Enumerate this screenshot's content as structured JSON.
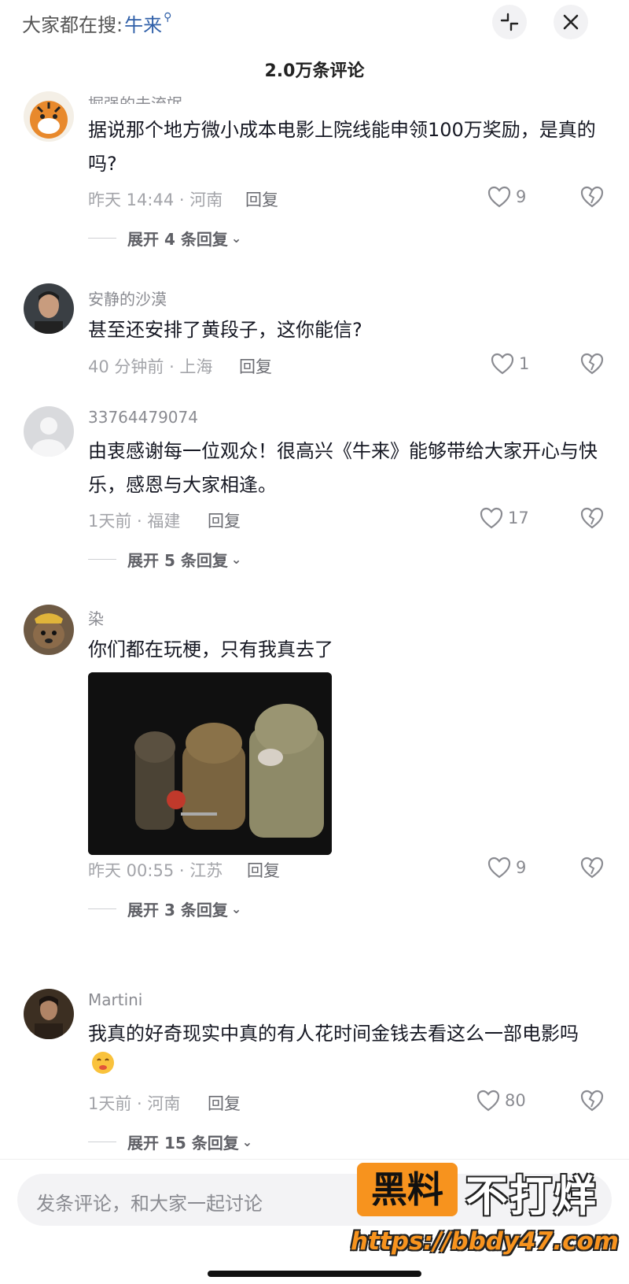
{
  "header": {
    "search_prefix": "大家都在搜:",
    "search_keyword": "牛来",
    "collapse_icon": "collapse-arrows-icon",
    "close_icon": "close-icon",
    "comment_count": "2.0万条评论"
  },
  "comments": [
    {
      "username": "掘强的未流氓",
      "text": "据说那个地方微小成本电影上院线能申领100万奖励，是真的吗?",
      "time_location": "昨天 14:44 · 河南",
      "reply": "回复",
      "likes": "9",
      "expand": "展开 4 条回复"
    },
    {
      "username": "安静的沙漠",
      "text": "甚至还安排了黄段子，这你能信?",
      "time_location": "40 分钟前 · 上海",
      "reply": "回复",
      "likes": "1"
    },
    {
      "username": "33764479074",
      "text": "由衷感谢每一位观众！很高兴《牛来》能够带给大家开心与快乐，感恩与大家相逢。",
      "time_location": "1天前 · 福建",
      "reply": "回复",
      "likes": "17",
      "expand": "展开 5 条回复"
    },
    {
      "username": "染",
      "text": "你们都在玩梗，只有我真去了",
      "time_location": "昨天 00:55 · 江苏",
      "reply": "回复",
      "likes": "9",
      "expand": "展开 3 条回复"
    },
    {
      "username": "Martini",
      "text": "我真的好奇现实中真的有人花时间金钱去看这么一部电影吗",
      "time_location": "1天前 · 河南",
      "reply": "回复",
      "likes": "80",
      "expand": "展开 15 条回复"
    }
  ],
  "footer": {
    "input_placeholder": "发条评论，和大家一起讨论",
    "watermark_box": "黑料",
    "watermark_text": "不打烊",
    "watermark_url": "https://bbdy47.com"
  },
  "colors": {
    "keyword": "#2f5fa8",
    "watermark_orange": "#f7931e"
  }
}
